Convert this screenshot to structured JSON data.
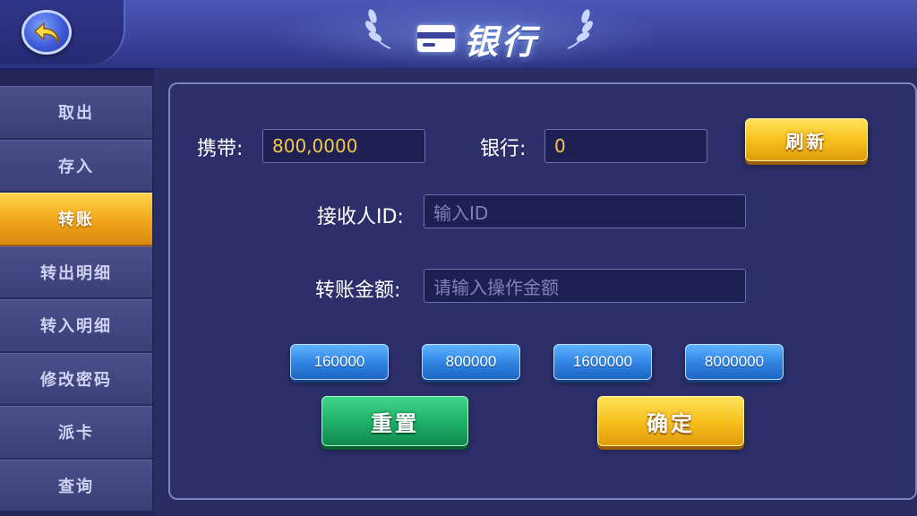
{
  "header": {
    "title": "银行",
    "back_icon": "back-arrow-icon",
    "card_icon": "bank-card-icon"
  },
  "sidebar": {
    "active_index": 2,
    "items": [
      {
        "label": "取出"
      },
      {
        "label": "存入"
      },
      {
        "label": "转账"
      },
      {
        "label": "转出明细"
      },
      {
        "label": "转入明细"
      },
      {
        "label": "修改密码"
      },
      {
        "label": "派卡"
      },
      {
        "label": "查询"
      }
    ]
  },
  "balances": {
    "carry_label": "携带:",
    "carry_value": "800,0000",
    "bank_label": "银行:",
    "bank_value": "0",
    "refresh_label": "刷新"
  },
  "transfer": {
    "receiver_label": "接收人ID:",
    "receiver_placeholder": "输入ID",
    "amount_label": "转账金额:",
    "amount_placeholder": "请输入操作金额"
  },
  "quick_amounts": [
    "160000",
    "800000",
    "1600000",
    "8000000"
  ],
  "actions": {
    "reset_label": "重置",
    "confirm_label": "确定"
  },
  "colors": {
    "accent_gold": "#f7c21e",
    "accent_green": "#1fb36a",
    "accent_blue": "#3287e4",
    "value_text": "#f3c64a"
  }
}
